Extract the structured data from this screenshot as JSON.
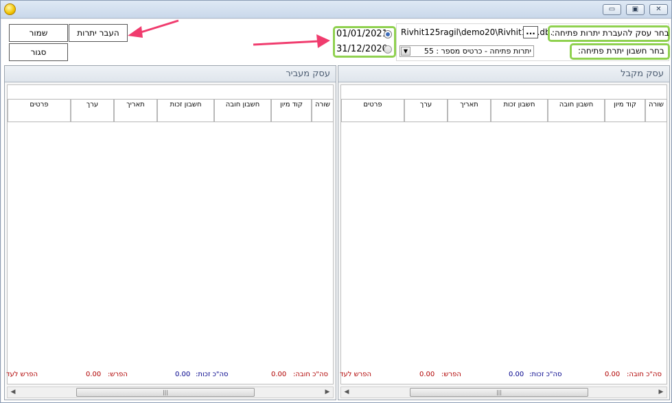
{
  "window": {
    "minimize": "▭",
    "maximize": "▣",
    "close": "✕"
  },
  "toolbar": {
    "save_label": "שמור",
    "transfer_label": "העבר יתרות",
    "close_label": "סגור"
  },
  "dates": {
    "option1": "01/01/2021",
    "option2": "31/12/2020"
  },
  "source": {
    "company_label": "בחר עסק להעברת יתרות פתיחה:",
    "company_path": "Rivhit125ragil\\demo20\\Rivhit125.db.",
    "browse_label": "...",
    "account_label": "בחר חשבון יתרת פתיחה:",
    "account_value": "יתרות פתיחה   -  כרטיס מספר : 55"
  },
  "panels": {
    "receiving": {
      "title": "עסק מקבל",
      "columns": [
        "שורה",
        "קוד מיון",
        "חשבון חובה",
        "חשבון זכות",
        "תאריך",
        "ערך",
        "פרטים"
      ],
      "totals": {
        "debit_label": "סה\"כ חובה:",
        "debit_value": "0.00",
        "credit_label": "סה\"כ זכות:",
        "credit_value": "0.00",
        "diff_label": "הפרש:",
        "diff_value": "0.00",
        "diff_to_label": "הפרש לעד"
      }
    },
    "transferring": {
      "title": "עסק מעביר",
      "columns": [
        "שורה",
        "קוד מיון",
        "חשבון חובה",
        "חשבון זכות",
        "תאריך",
        "ערך",
        "פרטים"
      ],
      "totals": {
        "debit_label": "סה\"כ חובה:",
        "debit_value": "0.00",
        "credit_label": "סה\"כ זכות:",
        "credit_value": "0.00",
        "diff_label": "הפרש:",
        "diff_value": "0.00",
        "diff_to_label": "הפרש לעד"
      }
    }
  },
  "colors": {
    "highlight": "#8fd14f",
    "arrow": "#f03c6e",
    "negative": "#b00000",
    "credit": "#00008b"
  }
}
